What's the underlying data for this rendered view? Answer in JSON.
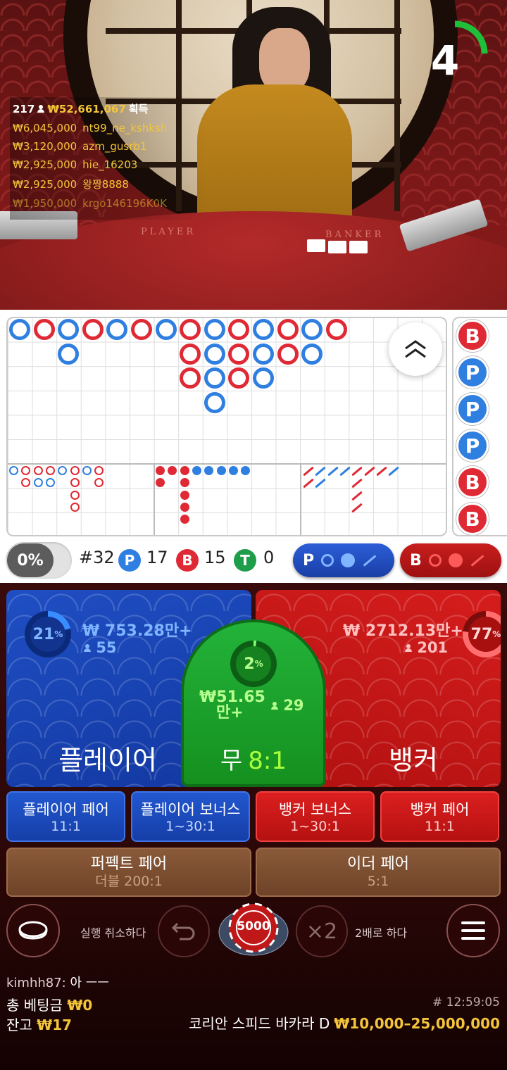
{
  "winners": {
    "count": "217",
    "total": "₩52,661,067",
    "suffix": "획득",
    "list": [
      {
        "amount": "₩6,045,000",
        "name": "nt99_ne_kshksh"
      },
      {
        "amount": "₩3,120,000",
        "name": "azm_gusrb1"
      },
      {
        "amount": "₩2,925,000",
        "name": "hie_16203"
      },
      {
        "amount": "₩2,925,000",
        "name": "왕짱8888"
      },
      {
        "amount": "₩1,950,000",
        "name": "krgo146196K0K"
      }
    ]
  },
  "timer": {
    "seconds": "4",
    "progress": 0.25,
    "color": "#1fbf3a"
  },
  "table_labels": {
    "player": "PLAYER",
    "banker": "BANKER"
  },
  "stats": {
    "percent_toggle": "0%",
    "round": "#32",
    "player_letter": "P",
    "player_count": "17",
    "banker_letter": "B",
    "banker_count": "15",
    "tie_letter": "T",
    "tie_count": "0",
    "predict_player": "P",
    "predict_banker": "B"
  },
  "colors": {
    "player": "#2f7fe0",
    "banker": "#df2a35",
    "tie": "#1e9e4a",
    "gold": "#f3c53a"
  },
  "big_road": [
    {
      "col": 0,
      "row": 0,
      "r": "P"
    },
    {
      "col": 1,
      "row": 0,
      "r": "B"
    },
    {
      "col": 2,
      "row": 0,
      "r": "P"
    },
    {
      "col": 2,
      "row": 1,
      "r": "P"
    },
    {
      "col": 3,
      "row": 0,
      "r": "B"
    },
    {
      "col": 4,
      "row": 0,
      "r": "P"
    },
    {
      "col": 5,
      "row": 0,
      "r": "B"
    },
    {
      "col": 6,
      "row": 0,
      "r": "P"
    },
    {
      "col": 7,
      "row": 0,
      "r": "B"
    },
    {
      "col": 7,
      "row": 1,
      "r": "B"
    },
    {
      "col": 7,
      "row": 2,
      "r": "B"
    },
    {
      "col": 8,
      "row": 0,
      "r": "P"
    },
    {
      "col": 8,
      "row": 1,
      "r": "P"
    },
    {
      "col": 8,
      "row": 2,
      "r": "P"
    },
    {
      "col": 8,
      "row": 3,
      "r": "P"
    },
    {
      "col": 9,
      "row": 0,
      "r": "B"
    },
    {
      "col": 9,
      "row": 1,
      "r": "B"
    },
    {
      "col": 9,
      "row": 2,
      "r": "B"
    },
    {
      "col": 10,
      "row": 0,
      "r": "P"
    },
    {
      "col": 10,
      "row": 1,
      "r": "P"
    },
    {
      "col": 10,
      "row": 2,
      "r": "P"
    },
    {
      "col": 11,
      "row": 0,
      "r": "B"
    },
    {
      "col": 11,
      "row": 1,
      "r": "B"
    },
    {
      "col": 12,
      "row": 0,
      "r": "P"
    },
    {
      "col": 12,
      "row": 1,
      "r": "P"
    },
    {
      "col": 13,
      "row": 0,
      "r": "B"
    }
  ],
  "bead_road": [
    "B",
    "P",
    "P",
    "P",
    "B",
    "B"
  ],
  "betting": {
    "player": {
      "label": "플레이어",
      "amount": "₩ 753.28만+",
      "players": "55",
      "percent": "21",
      "pct_sign": "%"
    },
    "tie": {
      "label": "무",
      "odds": "8:1",
      "amount_line1": "₩51.65",
      "amount_line2": "만+",
      "players": "29",
      "percent": "2",
      "pct_sign": "%"
    },
    "banker": {
      "label": "뱅커",
      "amount": "₩ 2712.13만+",
      "players": "201",
      "percent": "77",
      "pct_sign": "%"
    }
  },
  "side_bets": [
    {
      "label": "플레이어 페어",
      "odds": "11:1"
    },
    {
      "label": "플레이어 보너스",
      "odds": "1~30:1"
    },
    {
      "label": "뱅커 보너스",
      "odds": "1~30:1"
    },
    {
      "label": "뱅커 페어",
      "odds": "11:1"
    }
  ],
  "pair_bets": [
    {
      "label": "퍼펙트 페어",
      "odds": "더블 200:1"
    },
    {
      "label": "이더 페어",
      "odds": "5:1"
    }
  ],
  "controls": {
    "undo_label": "실행 취소하다",
    "chip_value": "5000",
    "double_symbol": "×2",
    "double_label": "2배로 하다"
  },
  "chat": {
    "user": "kimhh87:",
    "message": "아 ㅡㅡ"
  },
  "footer": {
    "total_bet_label": "총 베팅금",
    "total_bet_value": "₩0",
    "balance_label": "잔고",
    "balance_value": "₩17",
    "time": "# 12:59:05",
    "game_name": "코리안 스피드 바카라 D",
    "limits": "₩10,000–25,000,000"
  }
}
